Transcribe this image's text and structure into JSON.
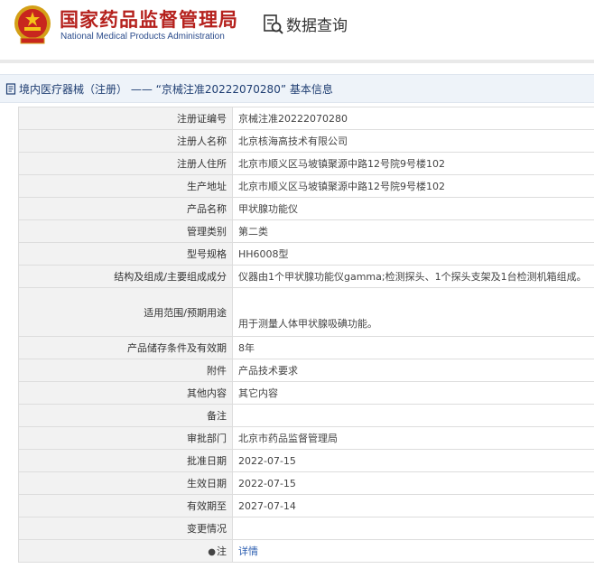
{
  "header": {
    "brand_cn": "国家药品监督管理局",
    "brand_en": "National Medical Products Administration",
    "query_label": "数据查询"
  },
  "section": {
    "title": "境内医疗器械（注册） —— “京械注准20222070280” 基本信息"
  },
  "rows": [
    {
      "label": "注册证编号",
      "value": "京械注准20222070280"
    },
    {
      "label": "注册人名称",
      "value": "北京核海高技术有限公司"
    },
    {
      "label": "注册人住所",
      "value": "北京市顺义区马坡镇聚源中路12号院9号楼102"
    },
    {
      "label": "生产地址",
      "value": "北京市顺义区马坡镇聚源中路12号院9号楼102"
    },
    {
      "label": "产品名称",
      "value": "甲状腺功能仪"
    },
    {
      "label": "管理类别",
      "value": "第二类"
    },
    {
      "label": "型号规格",
      "value": "HH6008型"
    },
    {
      "label": "结构及组成/主要组成成分",
      "value": "仪器由1个甲状腺功能仪gamma;检测探头、1个探头支架及1台检测机箱组成。"
    },
    {
      "label": "适用范围/预期用途",
      "value": "用于测量人体甲状腺吸碘功能。"
    },
    {
      "label": "产品储存条件及有效期",
      "value": "8年"
    },
    {
      "label": "附件",
      "value": "产品技术要求"
    },
    {
      "label": "其他内容",
      "value": "其它内容"
    },
    {
      "label": "备注",
      "value": ""
    },
    {
      "label": "审批部门",
      "value": "北京市药品监督管理局"
    },
    {
      "label": "批准日期",
      "value": "2022-07-15"
    },
    {
      "label": "生效日期",
      "value": "2022-07-15"
    },
    {
      "label": "有效期至",
      "value": "2027-07-14"
    },
    {
      "label": "变更情况",
      "value": ""
    },
    {
      "label": "注",
      "value": "详情"
    }
  ],
  "colors": {
    "brand_red": "#b5211d",
    "brand_blue": "#2b4c8c",
    "link_blue": "#2a5db0",
    "label_bg": "#f2f2f2",
    "section_bg": "#eef3f9"
  }
}
